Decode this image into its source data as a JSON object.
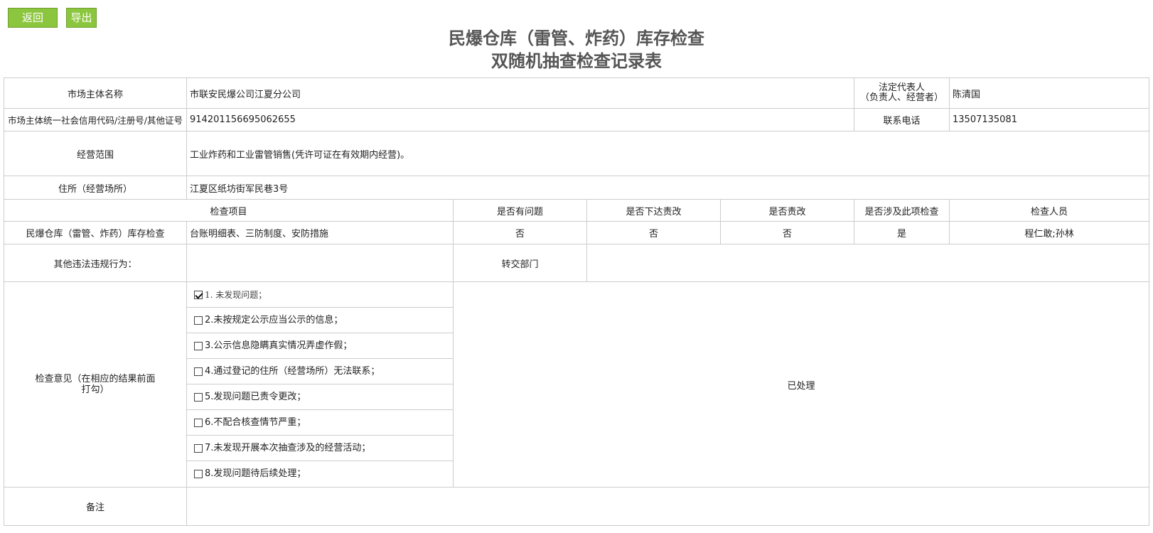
{
  "toolbar": {
    "back_label": "返回",
    "export_label": "导出"
  },
  "title": {
    "line1": "民爆仓库（雷管、炸药）库存检查",
    "line2": "双随机抽查检查记录表"
  },
  "subject": {
    "name_label": "市场主体名称",
    "name_value": "市联安民爆公司江夏分公司",
    "legal_rep_label_1": "法定代表人",
    "legal_rep_label_2": "（负责人、经营者）",
    "legal_rep_value": "陈清国",
    "credit_label": "市场主体统一社会信用代码/注册号/其他证号",
    "credit_value": "914201156695062655",
    "phone_label": "联系电话",
    "phone_value": "13507135081",
    "scope_label": "经营范围",
    "scope_value": "工业炸药和工业雷管销售(凭许可证在有效期内经营)。",
    "address_label": "住所（经营场所）",
    "address_value": "江夏区纸坊街军民巷3号"
  },
  "check_table": {
    "headers": [
      "检查项目",
      "是否有问题",
      "是否下达责改",
      "是否责改",
      "是否涉及此项检查",
      "检查人员"
    ],
    "row": {
      "item": "民爆仓库（雷管、炸药）库存检查",
      "content": "台账明细表、三防制度、安防措施",
      "has_problem": "否",
      "order_issued": "否",
      "rectified": "否",
      "involved": "是",
      "inspectors": "程仁敢;孙林"
    }
  },
  "other": {
    "violation_label": "其他违法违规行为：",
    "violation_value": "",
    "transfer_label": "转交部门",
    "transfer_value": ""
  },
  "opinion": {
    "label": "检查意见（在相应的结果前面打勾）",
    "options": [
      {
        "label": "1. 未发现问题；",
        "checked": true
      },
      {
        "label": "2.未按规定公示应当公示的信息；",
        "checked": false
      },
      {
        "label": "3.公示信息隐瞒真实情况弄虚作假；",
        "checked": false
      },
      {
        "label": "4.通过登记的住所（经营场所）无法联系；",
        "checked": false
      },
      {
        "label": "5.发现问题已责令更改；",
        "checked": false
      },
      {
        "label": "6.不配合核查情节严重；",
        "checked": false
      },
      {
        "label": "7.未发现开展本次抽查涉及的经营活动；",
        "checked": false
      },
      {
        "label": "8.发现问题待后续处理；",
        "checked": false
      }
    ],
    "result": "已处理"
  },
  "remark": {
    "label": "备注",
    "value": ""
  }
}
